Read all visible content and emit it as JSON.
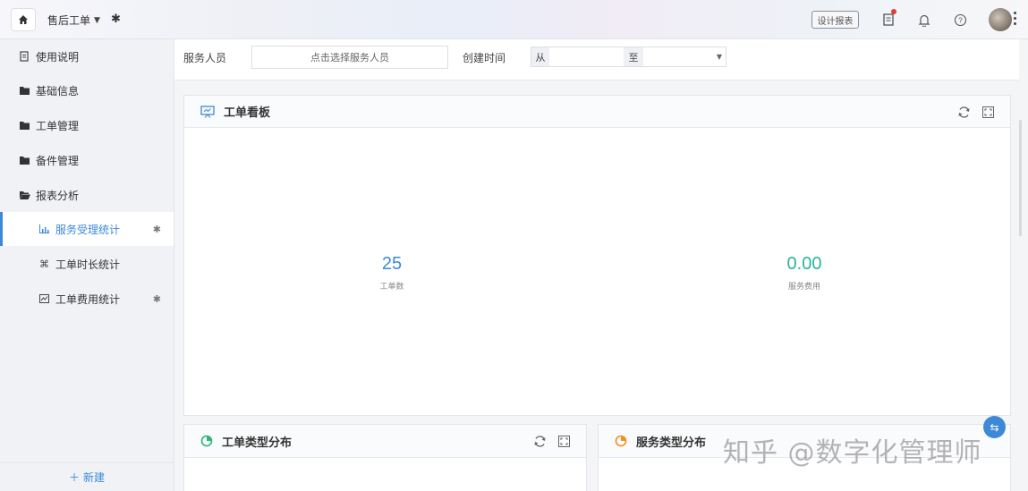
{
  "header": {
    "app_title": "售后工单",
    "design_report_label": "设计报表",
    "colors": {
      "accent": "#3d89d8",
      "notify_dot": "#e53935"
    }
  },
  "sidebar": {
    "items": [
      {
        "label": "使用说明",
        "icon": "document-icon"
      },
      {
        "label": "基础信息",
        "icon": "folder-icon"
      },
      {
        "label": "工单管理",
        "icon": "folder-icon"
      },
      {
        "label": "备件管理",
        "icon": "folder-icon"
      },
      {
        "label": "报表分析",
        "icon": "folder-open-icon"
      }
    ],
    "sub_items": [
      {
        "label": "服务受理统计",
        "icon": "bar-chart-icon",
        "active": true
      },
      {
        "label": "工单时长统计",
        "icon": "command-icon",
        "active": false
      },
      {
        "label": "工单费用统计",
        "icon": "line-chart-icon",
        "active": false
      }
    ],
    "new_label": "新建"
  },
  "filters": {
    "staff_label": "服务人员",
    "staff_placeholder": "点击选择服务人员",
    "created_label": "创建时间",
    "from_label": "从",
    "to_label": "至"
  },
  "board": {
    "title": "工单看板",
    "stats": [
      {
        "value": "25",
        "label": "工单数"
      },
      {
        "value": "0.00",
        "label": "服务费用"
      }
    ]
  },
  "panels": [
    {
      "title": "工单类型分布"
    },
    {
      "title": "服务类型分布"
    }
  ],
  "watermark": "知乎 @数字化管理师"
}
